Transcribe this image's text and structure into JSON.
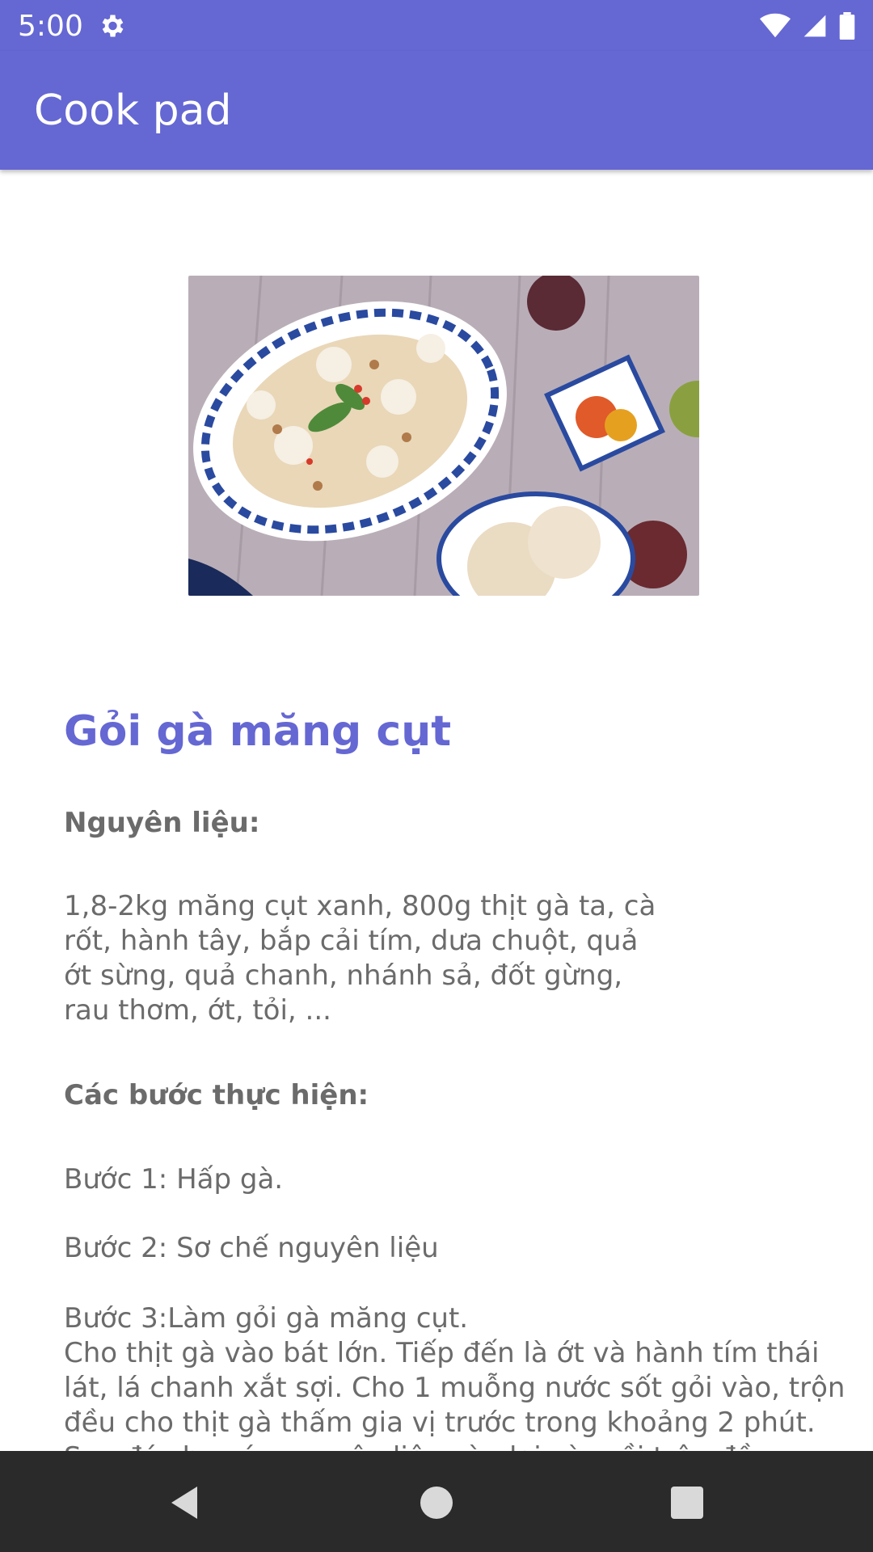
{
  "status": {
    "time": "5:00"
  },
  "app": {
    "title": "Cook pad"
  },
  "recipe": {
    "title": "Gỏi gà măng cụt",
    "ingredients_label": "Nguyên liệu:",
    "ingredients_lines": [
      "1,8-2kg măng cụt xanh, 800g thịt gà ta, cà",
      "rốt, hành tây, bắp cải tím, dưa chuột, quả",
      "ớt sừng, quả chanh, nhánh sả, đốt gừng,",
      "rau thơm, ớt, tỏi, ..."
    ],
    "steps_label": "Các bước thực hiện:",
    "step1": "Bước 1: Hấp gà.",
    "step2": "Bước 2: Sơ chế nguyên liệu",
    "step3_lines": [
      "Bước 3:Làm gỏi gà măng cụt.",
      "Cho thịt gà vào bát lớn. Tiếp đến là ớt và hành tím thái",
      "lát, lá chanh xắt sợi. Cho 1 muỗng nước sốt gỏi vào, trộn",
      "đều cho thịt gà thấm gia vị trước trong khoảng 2 phút.",
      "Sau đó cho các nguyên liệu còn lại vào rồi trộn đều"
    ]
  }
}
